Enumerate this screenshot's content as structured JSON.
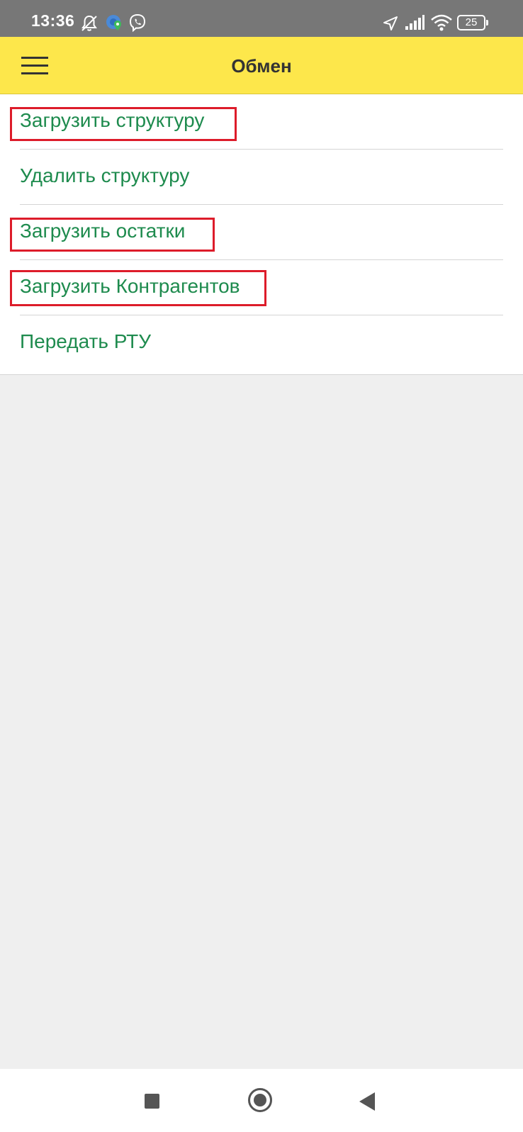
{
  "status_bar": {
    "time": "13:36",
    "battery": "25",
    "icons": [
      "bell-off-icon",
      "location-pin-icon",
      "viber-icon",
      "navigation-arrow-icon",
      "signal-icon",
      "wifi-icon",
      "battery-icon"
    ]
  },
  "app_bar": {
    "title": "Обмен",
    "menu_icon": "hamburger-menu-icon"
  },
  "menu": {
    "items": [
      {
        "label": "Загрузить структуру",
        "highlighted": true
      },
      {
        "label": "Удалить структуру",
        "highlighted": false
      },
      {
        "label": "Загрузить остатки",
        "highlighted": true
      },
      {
        "label": "Загрузить Контрагентов",
        "highlighted": true
      },
      {
        "label": "Передать РТУ",
        "highlighted": false
      }
    ]
  },
  "nav_bar": {
    "icons": [
      "recent-apps-icon",
      "home-icon",
      "back-icon"
    ]
  },
  "colors": {
    "app_bar": "#fde74b",
    "link_text": "#1e8b4e",
    "highlight_box": "#dd1c2a",
    "background": "#efefef"
  }
}
